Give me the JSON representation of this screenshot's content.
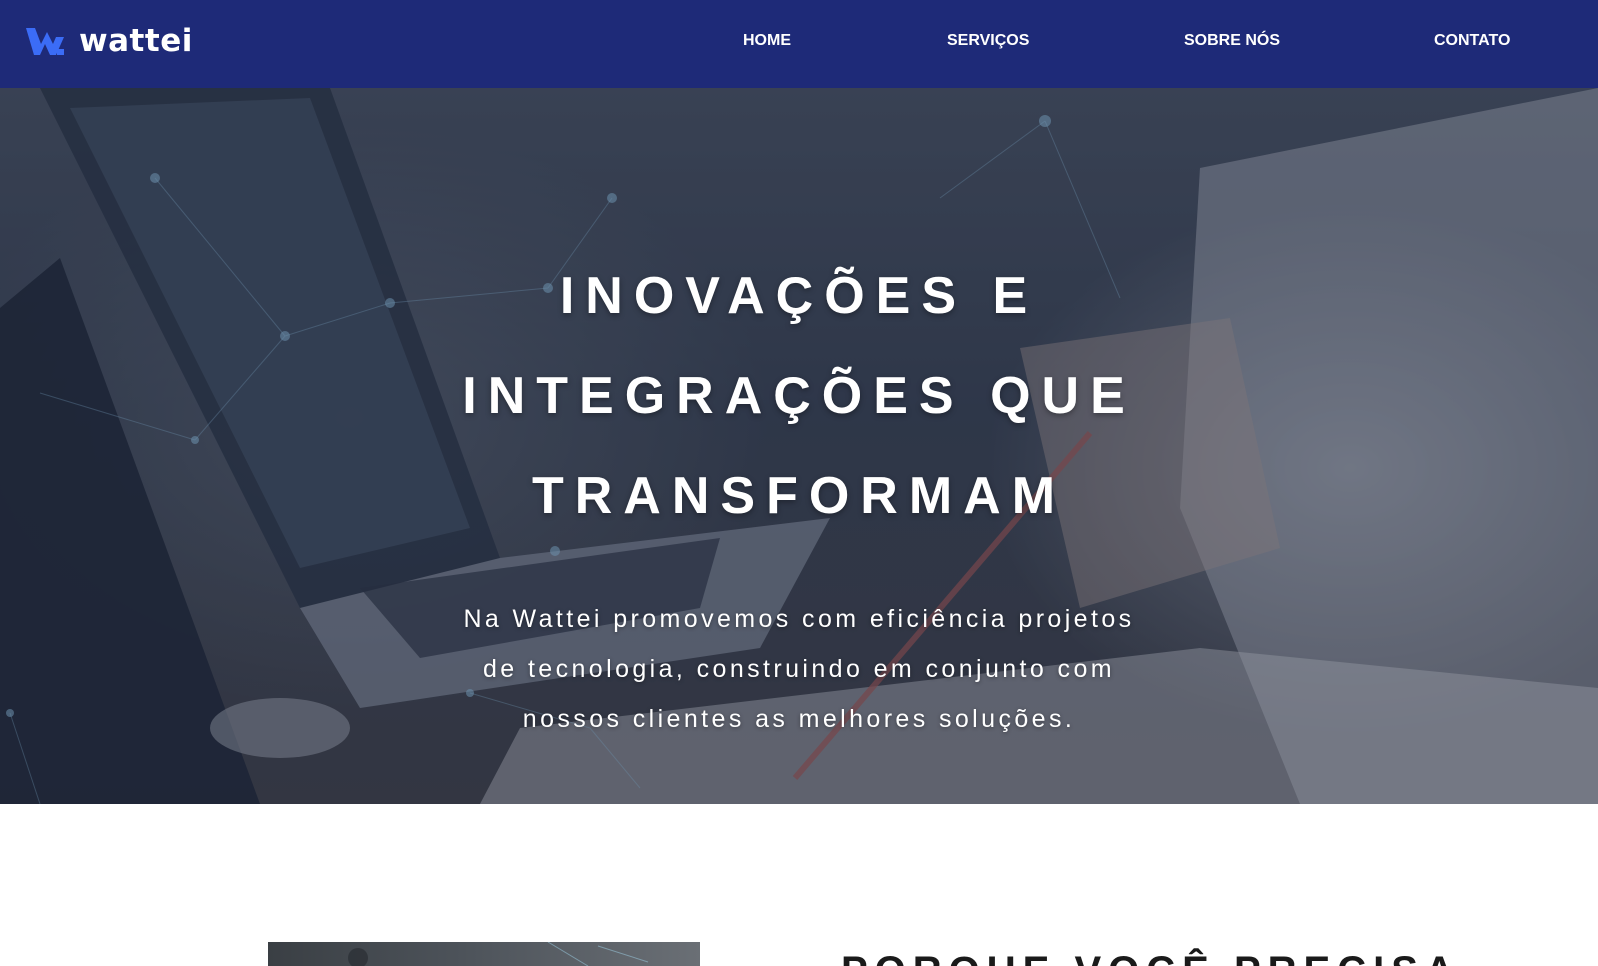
{
  "header": {
    "logo": {
      "icon": "wattei-logo-mark",
      "text": "wattei"
    },
    "nav": [
      {
        "label": "HOME"
      },
      {
        "label": "SERVIÇOS"
      },
      {
        "label": "SOBRE NÓS"
      },
      {
        "label": "CONTATO"
      }
    ]
  },
  "hero": {
    "background": "laptop-desk-photo",
    "title_lines": [
      "INOVAÇÕES E",
      "INTEGRAÇÕES QUE",
      "TRANSFORMAM"
    ],
    "subtitle_lines": [
      "Na Wattei promovemos com eficiência projetos",
      "de tecnologia, construindo em conjunto com",
      "nossos clientes as melhores soluções."
    ]
  },
  "section": {
    "heading": "PORQUE VOCÊ PRECISA"
  },
  "colors": {
    "header_bg": "#1e2a78",
    "logo_mark": "#3b6cf6",
    "text_light": "#ffffff",
    "heading_dark": "#1a1a1a"
  }
}
